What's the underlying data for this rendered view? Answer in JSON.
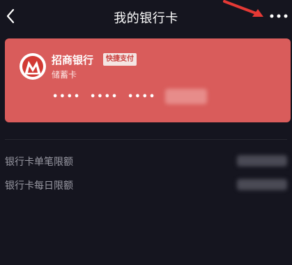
{
  "nav": {
    "title": "我的银行卡",
    "back_icon": "chevron-left-icon",
    "more_icon": "more-horizontal-icon"
  },
  "card": {
    "bank_name": "招商银行",
    "badge": "快捷支付",
    "card_type": "储蓄卡",
    "masked_groups": [
      "••••",
      "••••",
      "••••"
    ],
    "background_color": "#d95c5b",
    "logo_icon": "cmb-bank-logo-icon"
  },
  "limits": [
    {
      "label": "银行卡单笔限额"
    },
    {
      "label": "银行卡每日限额"
    }
  ],
  "colors": {
    "background": "#15151f",
    "annotation_arrow": "#e53935"
  }
}
